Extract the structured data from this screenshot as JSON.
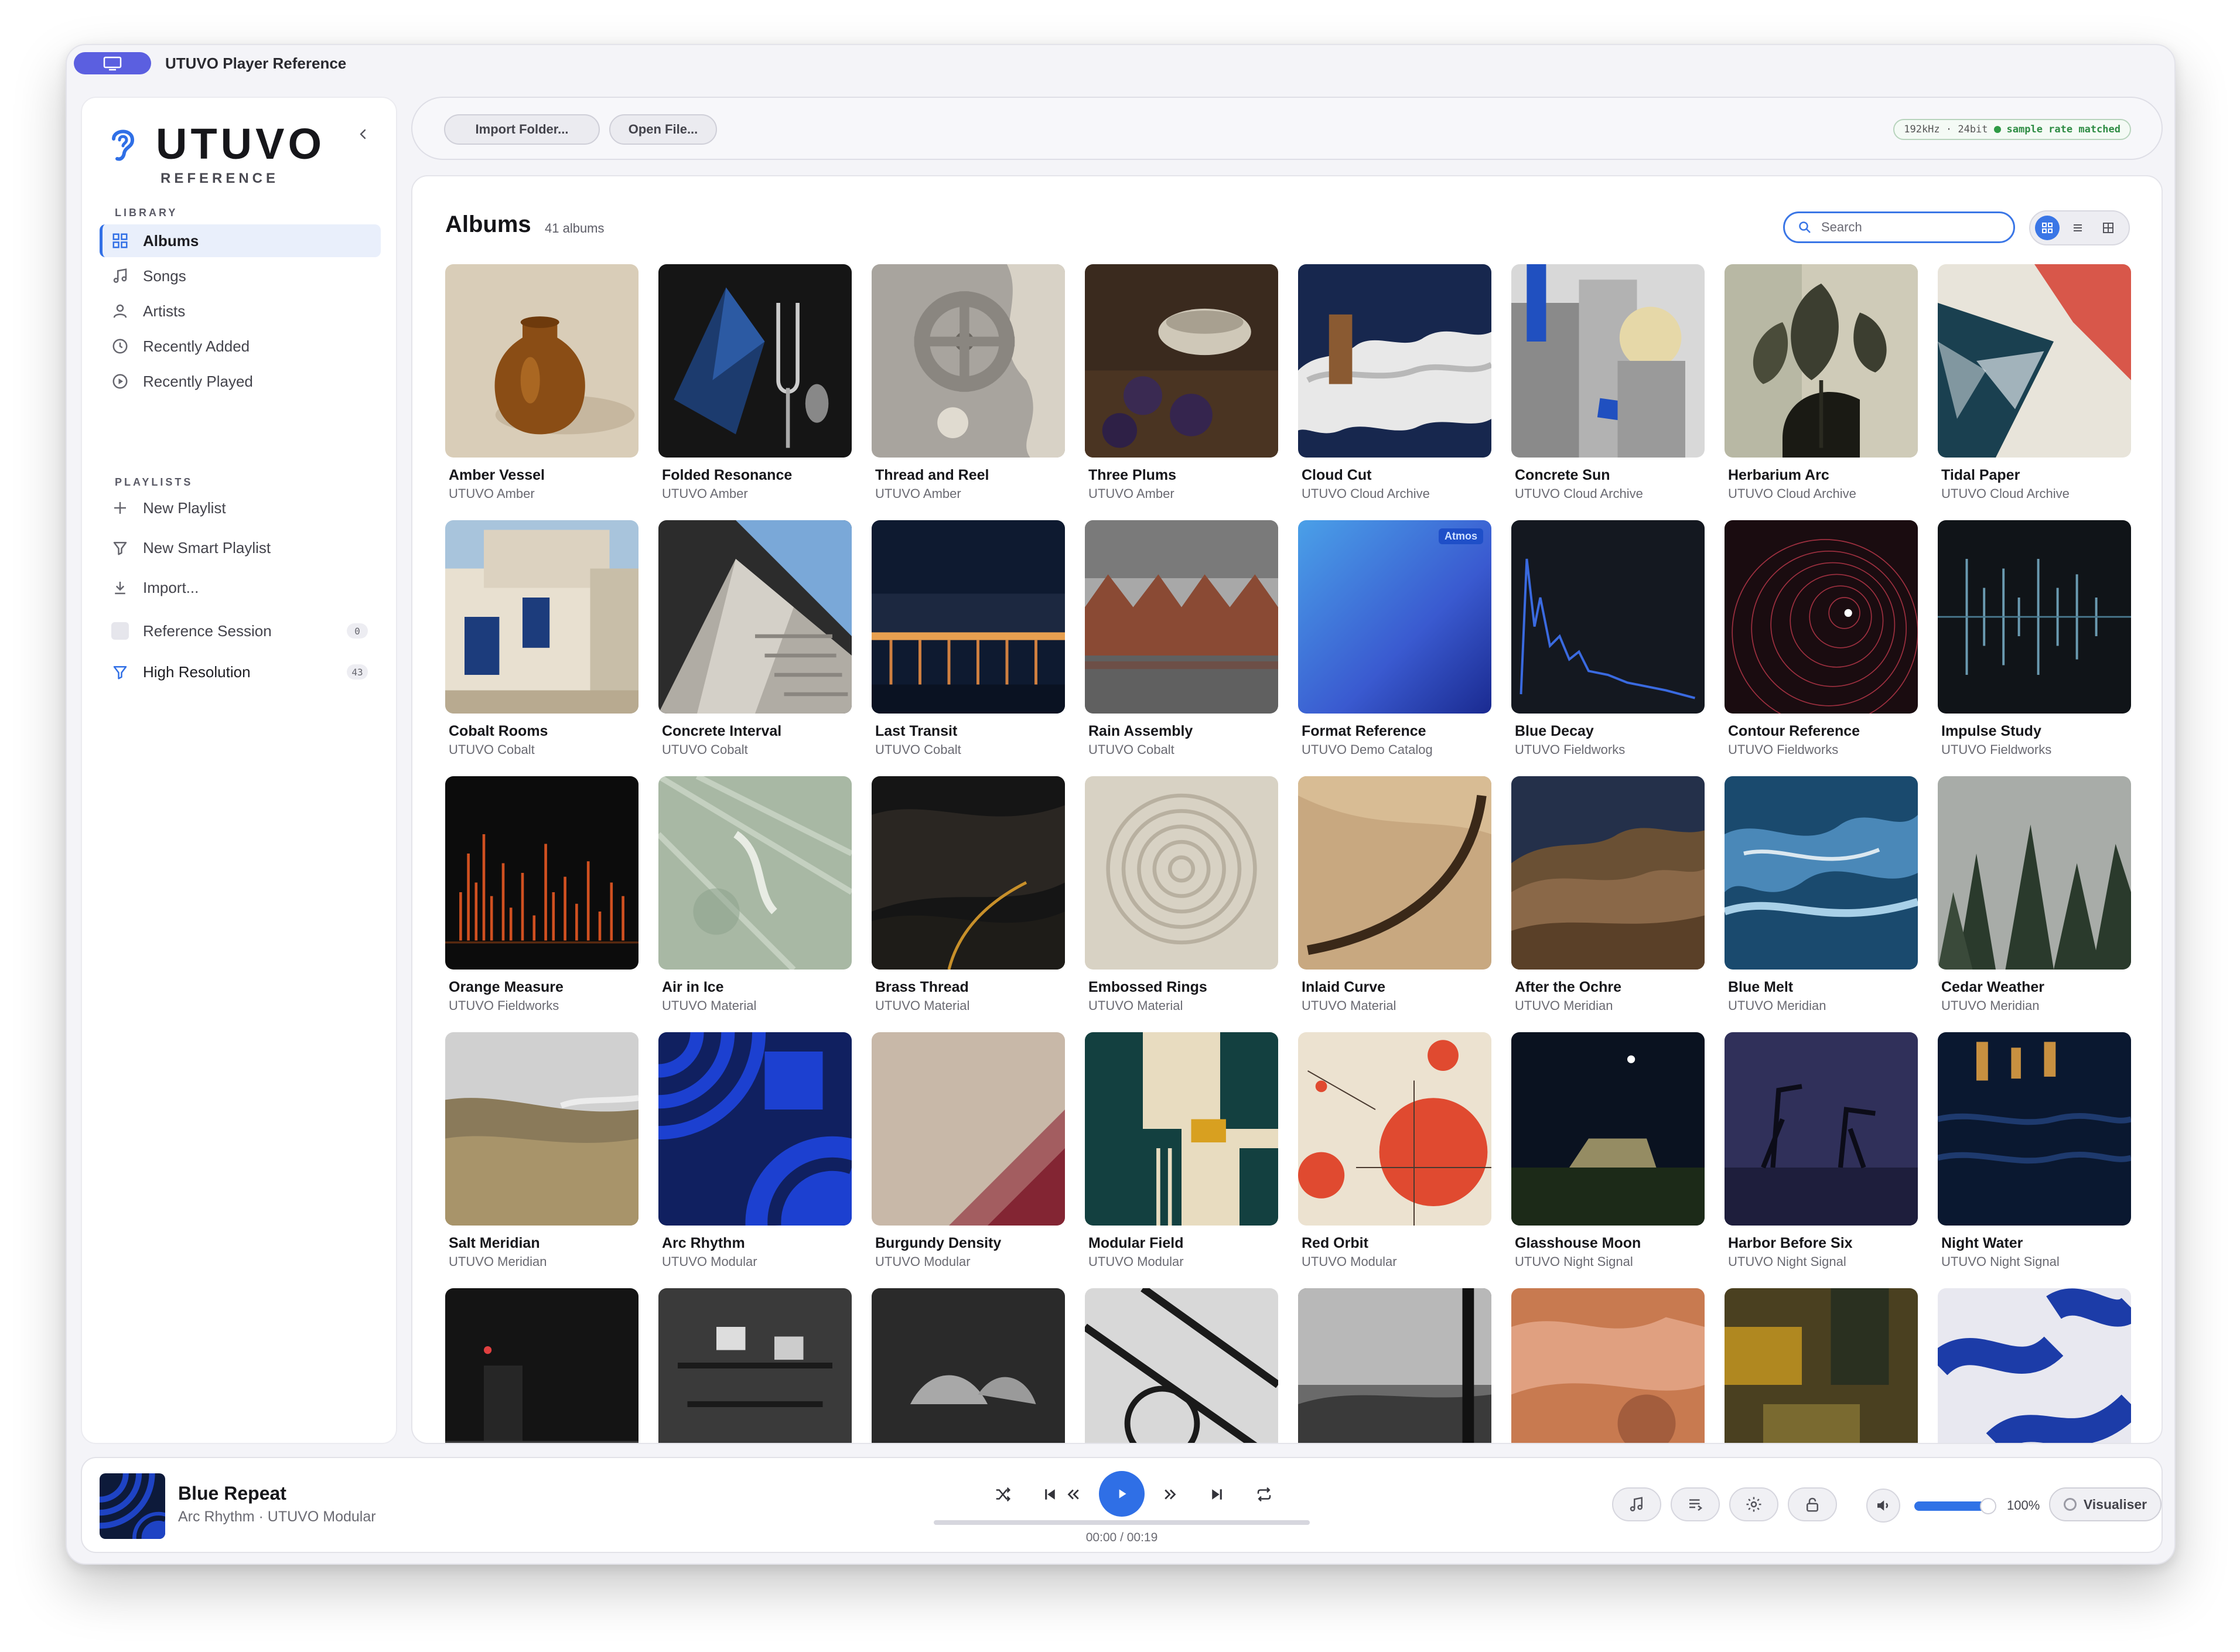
{
  "window": {
    "title": "UTUVO Player Reference"
  },
  "sidebar": {
    "logo": {
      "word": "UTUVO",
      "sub": "REFERENCE"
    },
    "library_label": "LIBRARY",
    "library": [
      {
        "label": "Albums",
        "icon": "grid-icon",
        "active": true
      },
      {
        "label": "Songs",
        "icon": "music-note-icon"
      },
      {
        "label": "Artists",
        "icon": "person-icon"
      },
      {
        "label": "Recently Added",
        "icon": "clock-icon"
      },
      {
        "label": "Recently Played",
        "icon": "play-circle-icon"
      }
    ],
    "playlists_label": "PLAYLISTS",
    "playlist_actions": [
      {
        "label": "New Playlist",
        "icon": "plus-icon"
      },
      {
        "label": "New Smart Playlist",
        "icon": "filter-icon"
      },
      {
        "label": "Import...",
        "icon": "download-icon"
      }
    ],
    "playlists": [
      {
        "label": "Reference Session",
        "count": "0",
        "icon": "checkbox-icon"
      },
      {
        "label": "High Resolution",
        "count": "43",
        "icon": "filter-icon"
      }
    ]
  },
  "toolbar": {
    "import_folder": "Import Folder...",
    "open_file": "Open File...",
    "status": {
      "rate": "192kHz · 24bit",
      "state": "sample rate matched",
      "state_color": "#2e9a45"
    }
  },
  "main": {
    "title": "Albums",
    "count": "41 albums",
    "search_placeholder": "Search",
    "view_modes": [
      "grid",
      "list",
      "compact-grid"
    ],
    "active_view": "grid"
  },
  "albums": [
    {
      "title": "Amber Vessel",
      "artist": "UTUVO Amber"
    },
    {
      "title": "Folded Resonance",
      "artist": "UTUVO Amber"
    },
    {
      "title": "Thread and Reel",
      "artist": "UTUVO Amber"
    },
    {
      "title": "Three Plums",
      "artist": "UTUVO Amber"
    },
    {
      "title": "Cloud Cut",
      "artist": "UTUVO Cloud Archive"
    },
    {
      "title": "Concrete Sun",
      "artist": "UTUVO Cloud Archive"
    },
    {
      "title": "Herbarium Arc",
      "artist": "UTUVO Cloud Archive"
    },
    {
      "title": "Tidal Paper",
      "artist": "UTUVO Cloud Archive"
    },
    {
      "title": "Cobalt Rooms",
      "artist": "UTUVO Cobalt"
    },
    {
      "title": "Concrete Interval",
      "artist": "UTUVO Cobalt"
    },
    {
      "title": "Last Transit",
      "artist": "UTUVO Cobalt"
    },
    {
      "title": "Rain Assembly",
      "artist": "UTUVO Cobalt"
    },
    {
      "title": "Format Reference",
      "artist": "UTUVO Demo Catalog",
      "badge": "Atmos"
    },
    {
      "title": "Blue Decay",
      "artist": "UTUVO Fieldworks"
    },
    {
      "title": "Contour Reference",
      "artist": "UTUVO Fieldworks"
    },
    {
      "title": "Impulse Study",
      "artist": "UTUVO Fieldworks"
    },
    {
      "title": "Orange Measure",
      "artist": "UTUVO Fieldworks"
    },
    {
      "title": "Air in Ice",
      "artist": "UTUVO Material"
    },
    {
      "title": "Brass Thread",
      "artist": "UTUVO Material"
    },
    {
      "title": "Embossed Rings",
      "artist": "UTUVO Material"
    },
    {
      "title": "Inlaid Curve",
      "artist": "UTUVO Material"
    },
    {
      "title": "After the Ochre",
      "artist": "UTUVO Meridian"
    },
    {
      "title": "Blue Melt",
      "artist": "UTUVO Meridian"
    },
    {
      "title": "Cedar Weather",
      "artist": "UTUVO Meridian"
    },
    {
      "title": "Salt Meridian",
      "artist": "UTUVO Meridian"
    },
    {
      "title": "Arc Rhythm",
      "artist": "UTUVO Modular"
    },
    {
      "title": "Burgundy Density",
      "artist": "UTUVO Modular"
    },
    {
      "title": "Modular Field",
      "artist": "UTUVO Modular"
    },
    {
      "title": "Red Orbit",
      "artist": "UTUVO Modular"
    },
    {
      "title": "Glasshouse Moon",
      "artist": "UTUVO Night Signal"
    },
    {
      "title": "Harbor Before Six",
      "artist": "UTUVO Night Signal"
    },
    {
      "title": "Night Water",
      "artist": "UTUVO Night Signal"
    },
    {
      "title": "",
      "artist": ""
    },
    {
      "title": "",
      "artist": ""
    },
    {
      "title": "",
      "artist": ""
    },
    {
      "title": "",
      "artist": ""
    },
    {
      "title": "",
      "artist": ""
    },
    {
      "title": "",
      "artist": ""
    },
    {
      "title": "",
      "artist": ""
    },
    {
      "title": "",
      "artist": ""
    }
  ],
  "player": {
    "title": "Blue Repeat",
    "subtitle": "Arc Rhythm · UTUVO Modular",
    "time": "00:00 / 00:19",
    "progress": 0,
    "volume": 1.0,
    "volume_label": "100%",
    "visualiser_label": "Visualiser",
    "accent": "#2f6fe6"
  }
}
